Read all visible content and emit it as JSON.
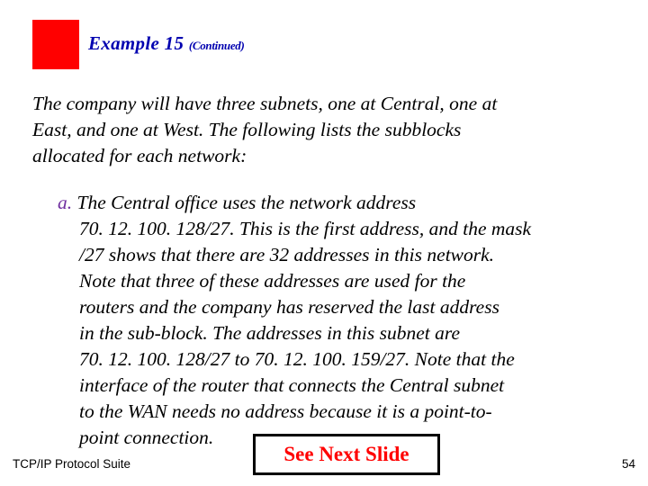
{
  "slide": {
    "title_main": "Example 15",
    "title_suffix": "(Continued)",
    "intro_lines": [
      "The company will have three subnets, one at Central, one at",
      "East, and one at West. The following lists the subblocks",
      "allocated for each network:"
    ],
    "item_marker": "a.",
    "body_lines": [
      "The Central office uses the network address",
      "70. 12. 100. 128/27. This is the first address, and the mask",
      "/27 shows that there are 32 addresses in this network.",
      "Note that three of these addresses are used for the",
      "routers and the company has reserved the last address",
      "in the sub-block. The addresses in this subnet are",
      "70. 12. 100. 128/27 to 70. 12. 100. 159/27. Note that the",
      "interface of the router that connects the Central subnet",
      "to the WAN needs no address because it is a point-to-",
      "point connection."
    ],
    "callout_label": "See Next Slide",
    "footer_left": "TCP/IP Protocol Suite",
    "footer_right": "54",
    "colors": {
      "title_blue": "#0000b0",
      "red_block": "#ff0000",
      "marker_purple": "#7030a0",
      "callout_red": "#ff0000",
      "text_black": "#000000"
    }
  }
}
